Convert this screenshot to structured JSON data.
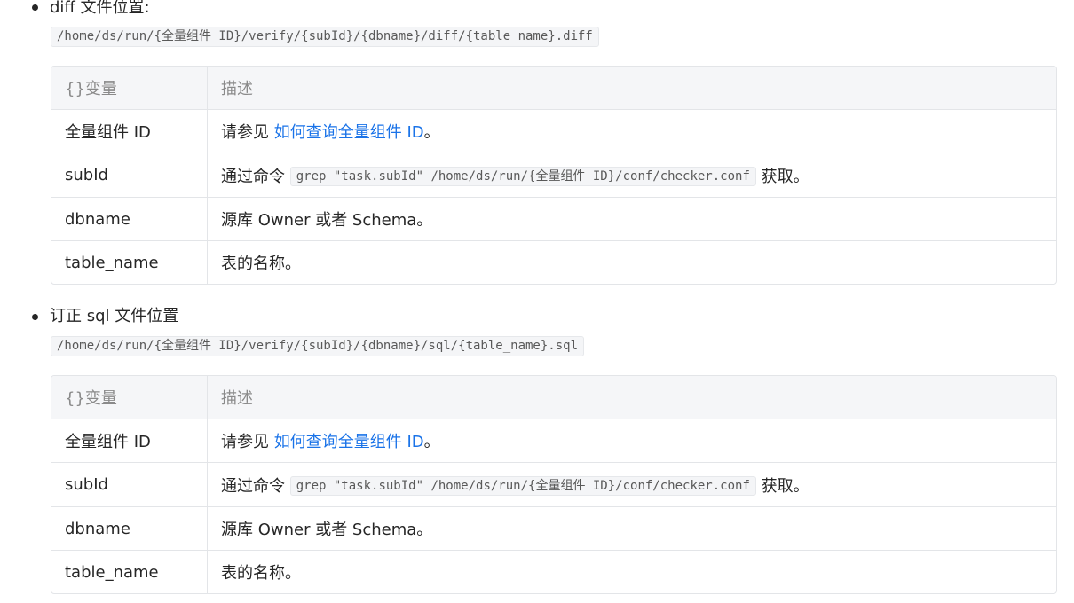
{
  "sections": [
    {
      "heading": "diff 文件位置:",
      "path": "/home/ds/run/{全量组件 ID}/verify/{subId}/{dbname}/diff/{table_name}.diff",
      "table": {
        "headers": [
          "{}变量",
          "描述"
        ],
        "rows": [
          {
            "var": "全量组件 ID",
            "desc_prefix": "请参见 ",
            "desc_link": "如何查询全量组件 ID",
            "desc_suffix": "。"
          },
          {
            "var": "subId",
            "desc_prefix": "通过命令 ",
            "desc_code": "grep \"task.subId\" /home/ds/run/{全量组件 ID}/conf/checker.conf",
            "desc_suffix": " 获取。"
          },
          {
            "var": "dbname",
            "desc": "源库 Owner 或者 Schema。"
          },
          {
            "var": "table_name",
            "desc": "表的名称。"
          }
        ]
      }
    },
    {
      "heading": "订正 sql 文件位置",
      "path": "/home/ds/run/{全量组件 ID}/verify/{subId}/{dbname}/sql/{table_name}.sql",
      "table": {
        "headers": [
          "{}变量",
          "描述"
        ],
        "rows": [
          {
            "var": "全量组件 ID",
            "desc_prefix": "请参见 ",
            "desc_link": "如何查询全量组件 ID",
            "desc_suffix": "。"
          },
          {
            "var": "subId",
            "desc_prefix": "通过命令 ",
            "desc_code": "grep \"task.subId\" /home/ds/run/{全量组件 ID}/conf/checker.conf",
            "desc_suffix": " 获取。"
          },
          {
            "var": "dbname",
            "desc": "源库 Owner 或者 Schema。"
          },
          {
            "var": "table_name",
            "desc": "表的名称。"
          }
        ]
      }
    }
  ]
}
